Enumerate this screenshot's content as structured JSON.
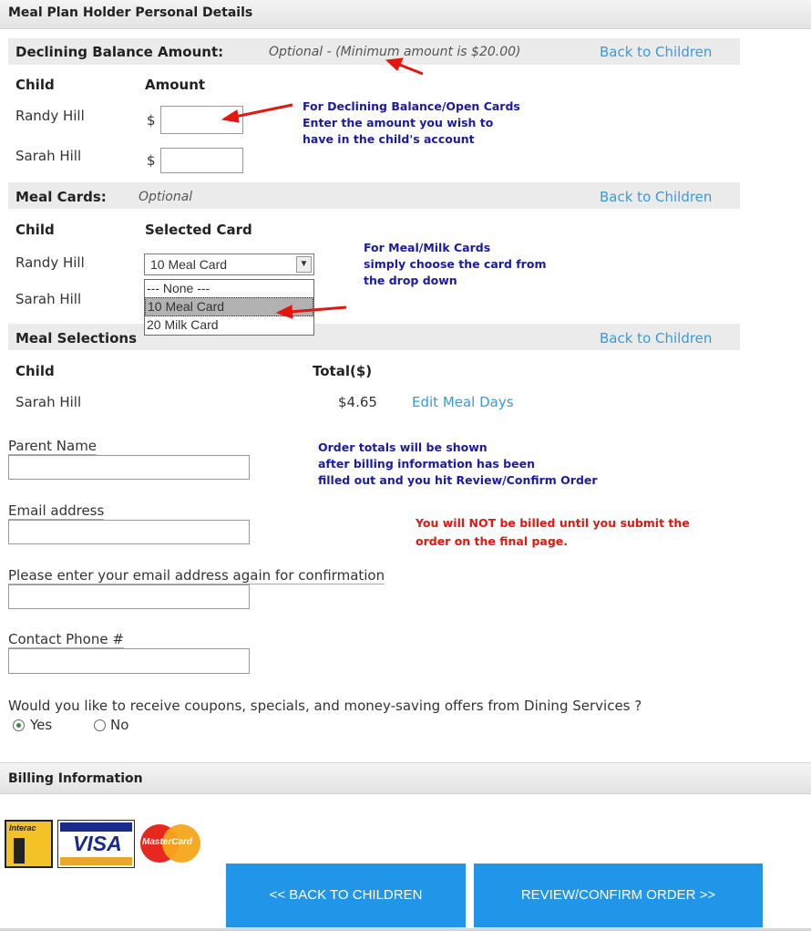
{
  "header": {
    "title": "Meal Plan Holder Personal Details"
  },
  "declining": {
    "title": "Declining Balance Amount:",
    "note": "Optional - (Minimum amount is $20.00)",
    "back_link": "Back to Children",
    "col_child": "Child",
    "col_amount": "Amount",
    "currency": "$",
    "rows": [
      {
        "name": "Randy Hill",
        "amount": ""
      },
      {
        "name": "Sarah Hill",
        "amount": ""
      }
    ],
    "annotation": [
      "For Declining Balance/Open Cards",
      "Enter the amount you wish to",
      "have in the child's account"
    ]
  },
  "meal_cards": {
    "title": "Meal Cards:",
    "note": "Optional",
    "back_link": "Back to Children",
    "col_child": "Child",
    "col_card": "Selected Card",
    "rows": [
      {
        "name": "Randy Hill"
      },
      {
        "name": "Sarah Hill"
      }
    ],
    "selected": "10 Meal Card",
    "options": [
      "--- None ---",
      "10 Meal Card",
      "20 Milk Card"
    ],
    "annotation": [
      "For Meal/Milk Cards",
      "simply choose the card from",
      "the drop down"
    ]
  },
  "meal_selections": {
    "title": "Meal Selections",
    "back_link": "Back to Children",
    "col_child": "Child",
    "col_total": "Total($)",
    "rows": [
      {
        "name": "Sarah Hill",
        "total": "$4.65",
        "edit": "Edit Meal Days"
      }
    ]
  },
  "form": {
    "parent_name_label": "Parent Name",
    "email_label": "Email address",
    "email_confirm_label": "Please enter your email address again for confirmation",
    "phone_label": "Contact Phone #",
    "coupons_question": "Would you like to receive coupons, specials, and money-saving offers from Dining Services ?",
    "yes_label": "Yes",
    "no_label": "No",
    "yes_selected": true
  },
  "annotations": {
    "order_totals": [
      "Order totals will be shown",
      "after billing information has been",
      "filled out and you hit Review/Confirm Order"
    ],
    "billing_note": [
      "You will NOT be billed until you submit the",
      "order on the final page."
    ]
  },
  "billing": {
    "title": "Billing Information",
    "cards": [
      "Interac",
      "VISA",
      "MasterCard"
    ]
  },
  "buttons": {
    "back": "<< BACK TO CHILDREN",
    "review": "REVIEW/CONFIRM ORDER >>"
  },
  "colors": {
    "accent": "#2196e9",
    "link": "#3a9ad9",
    "annotation_blue": "#1a1aa6",
    "annotation_red": "#e4160d"
  }
}
